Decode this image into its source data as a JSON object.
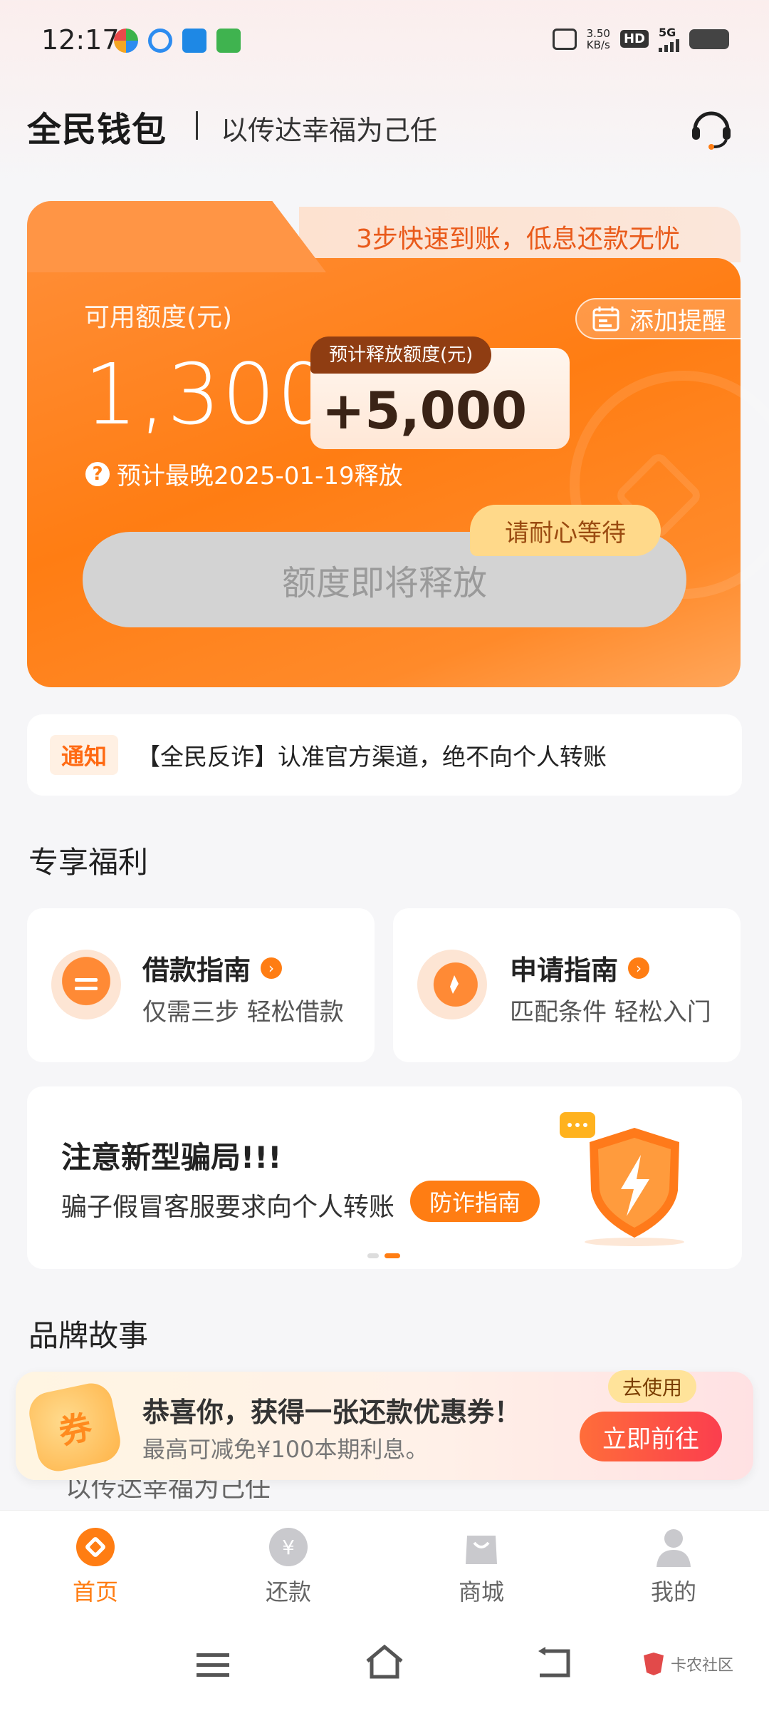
{
  "status_bar": {
    "time": "12:17",
    "speed_value": "3.50",
    "speed_unit": "KB/s",
    "hd_label": "HD",
    "network": "5G"
  },
  "header": {
    "app_title": "全民钱包",
    "slogan": "以传达幸福为己任"
  },
  "credit_card": {
    "tab_text": "3步快速到账，低息还款无忧",
    "limit_label": "可用额度(元)",
    "limit_amount": "1,300",
    "reminder_label": "添加提醒",
    "release_tag": "预计释放额度(元)",
    "release_amount": "+5,000",
    "latest_release": "预计最晚2025-01-19释放",
    "release_button": "额度即将释放",
    "wait_bubble": "请耐心等待"
  },
  "notice": {
    "badge": "通知",
    "text": "【全民反诈】认准官方渠道，绝不向个人转账"
  },
  "benefits": {
    "section_title": "专享福利",
    "cards": [
      {
        "title": "借款指南",
        "subtitle": "仅需三步 轻松借款"
      },
      {
        "title": "申请指南",
        "subtitle": "匹配条件 轻松入门"
      }
    ]
  },
  "fraud_banner": {
    "title": "注意新型骗局!!!",
    "subtitle": "骗子假冒客服要求向个人转账",
    "button": "防诈指南"
  },
  "brand": {
    "section_title": "品牌故事",
    "partial_text": "以传达幸福为己任"
  },
  "coupon_popup": {
    "icon_text": "券",
    "title": "恭喜你，获得一张还款优惠券！",
    "subtitle": "最高可减免¥100本期利息。",
    "tag": "去使用",
    "button": "立即前往"
  },
  "bottom_nav": {
    "items": [
      {
        "label": "首页",
        "active": true
      },
      {
        "label": "还款",
        "active": false
      },
      {
        "label": "商城",
        "active": false
      },
      {
        "label": "我的",
        "active": false
      }
    ]
  },
  "watermark": "卡农社区",
  "colors": {
    "accent": "#ff7d13",
    "text": "#222222",
    "inactive": "#666666",
    "background": "#f6f6f8"
  }
}
